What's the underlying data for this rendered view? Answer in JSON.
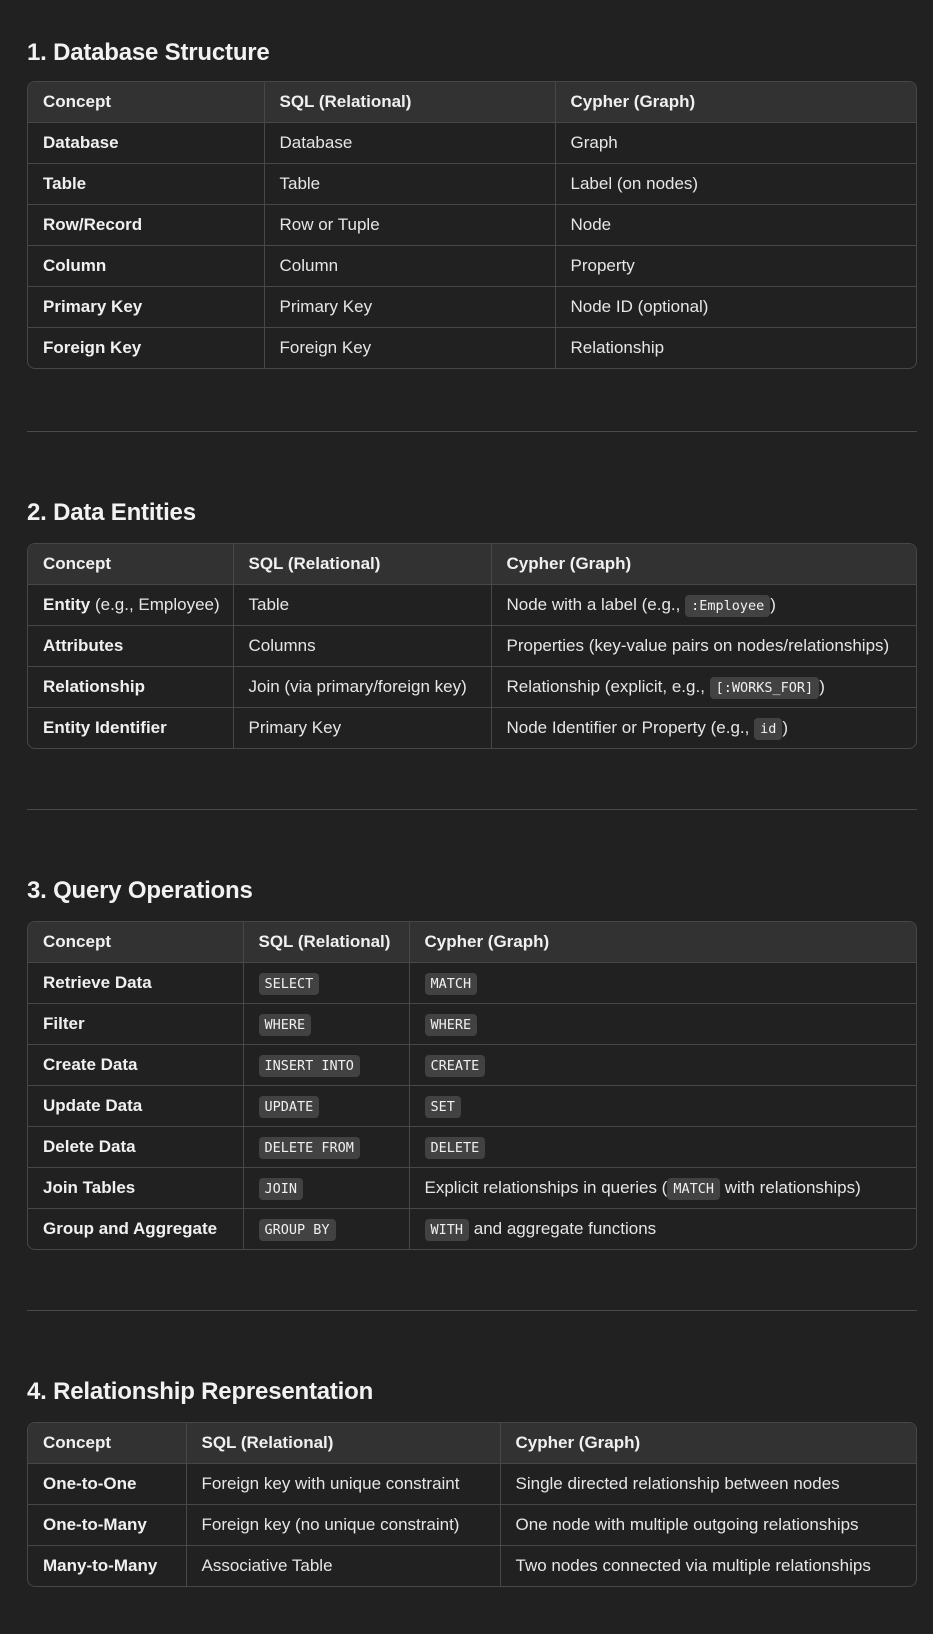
{
  "sections": [
    {
      "title": "1. Database Structure",
      "headers": [
        "Concept",
        "SQL (Relational)",
        "Cypher (Graph)"
      ],
      "rows": [
        [
          "Database",
          "Database",
          "Graph"
        ],
        [
          "Table",
          "Table",
          "Label (on nodes)"
        ],
        [
          "Row/Record",
          "Row or Tuple",
          "Node"
        ],
        [
          "Column",
          "Column",
          "Property"
        ],
        [
          "Primary Key",
          "Primary Key",
          "Node ID (optional)"
        ],
        [
          "Foreign Key",
          "Foreign Key",
          "Relationship"
        ]
      ]
    },
    {
      "title": "2. Data Entities",
      "headers": [
        "Concept",
        "SQL (Relational)",
        "Cypher (Graph)"
      ],
      "rows": [
        {
          "concept": "Entity",
          "concept_note": " (e.g., Employee)",
          "sql": "Table",
          "cypher_pre": "Node with a label (e.g., ",
          "cypher_code": ":Employee",
          "cypher_post": ")"
        },
        {
          "concept": "Attributes",
          "sql": "Columns",
          "cypher": "Properties (key-value pairs on nodes/relationships)"
        },
        {
          "concept": "Relationship",
          "sql": "Join (via primary/foreign key)",
          "cypher_pre": "Relationship (explicit, e.g., ",
          "cypher_code": "[:WORKS_FOR]",
          "cypher_post": ")"
        },
        {
          "concept": "Entity Identifier",
          "sql": "Primary Key",
          "cypher_pre": "Node Identifier or Property (e.g., ",
          "cypher_code": "id",
          "cypher_post": ")"
        }
      ]
    },
    {
      "title": "3. Query Operations",
      "headers": [
        "Concept",
        "SQL (Relational)",
        "Cypher (Graph)"
      ],
      "rows": [
        {
          "concept": "Retrieve Data",
          "sql_code": "SELECT",
          "cypher_code": "MATCH"
        },
        {
          "concept": "Filter",
          "sql_code": "WHERE",
          "cypher_code": "WHERE"
        },
        {
          "concept": "Create Data",
          "sql_code": "INSERT INTO",
          "cypher_code": "CREATE"
        },
        {
          "concept": "Update Data",
          "sql_code": "UPDATE",
          "cypher_code": "SET"
        },
        {
          "concept": "Delete Data",
          "sql_code": "DELETE FROM",
          "cypher_code": "DELETE"
        },
        {
          "concept": "Join Tables",
          "sql_code": "JOIN",
          "cypher_pre": "Explicit relationships in queries (",
          "cypher_code": "MATCH",
          "cypher_post": " with relationships)"
        },
        {
          "concept": "Group and Aggregate",
          "sql_code": "GROUP BY",
          "cypher_code": "WITH",
          "cypher_post": " and aggregate functions"
        }
      ]
    },
    {
      "title": "4. Relationship Representation",
      "headers": [
        "Concept",
        "SQL (Relational)",
        "Cypher (Graph)"
      ],
      "rows": [
        [
          "One-to-One",
          "Foreign key with unique constraint",
          "Single directed relationship between nodes"
        ],
        [
          "One-to-Many",
          "Foreign key (no unique constraint)",
          "One node with multiple outgoing relationships"
        ],
        [
          "Many-to-Many",
          "Associative Table",
          "Two nodes connected via multiple relationships"
        ]
      ]
    }
  ]
}
